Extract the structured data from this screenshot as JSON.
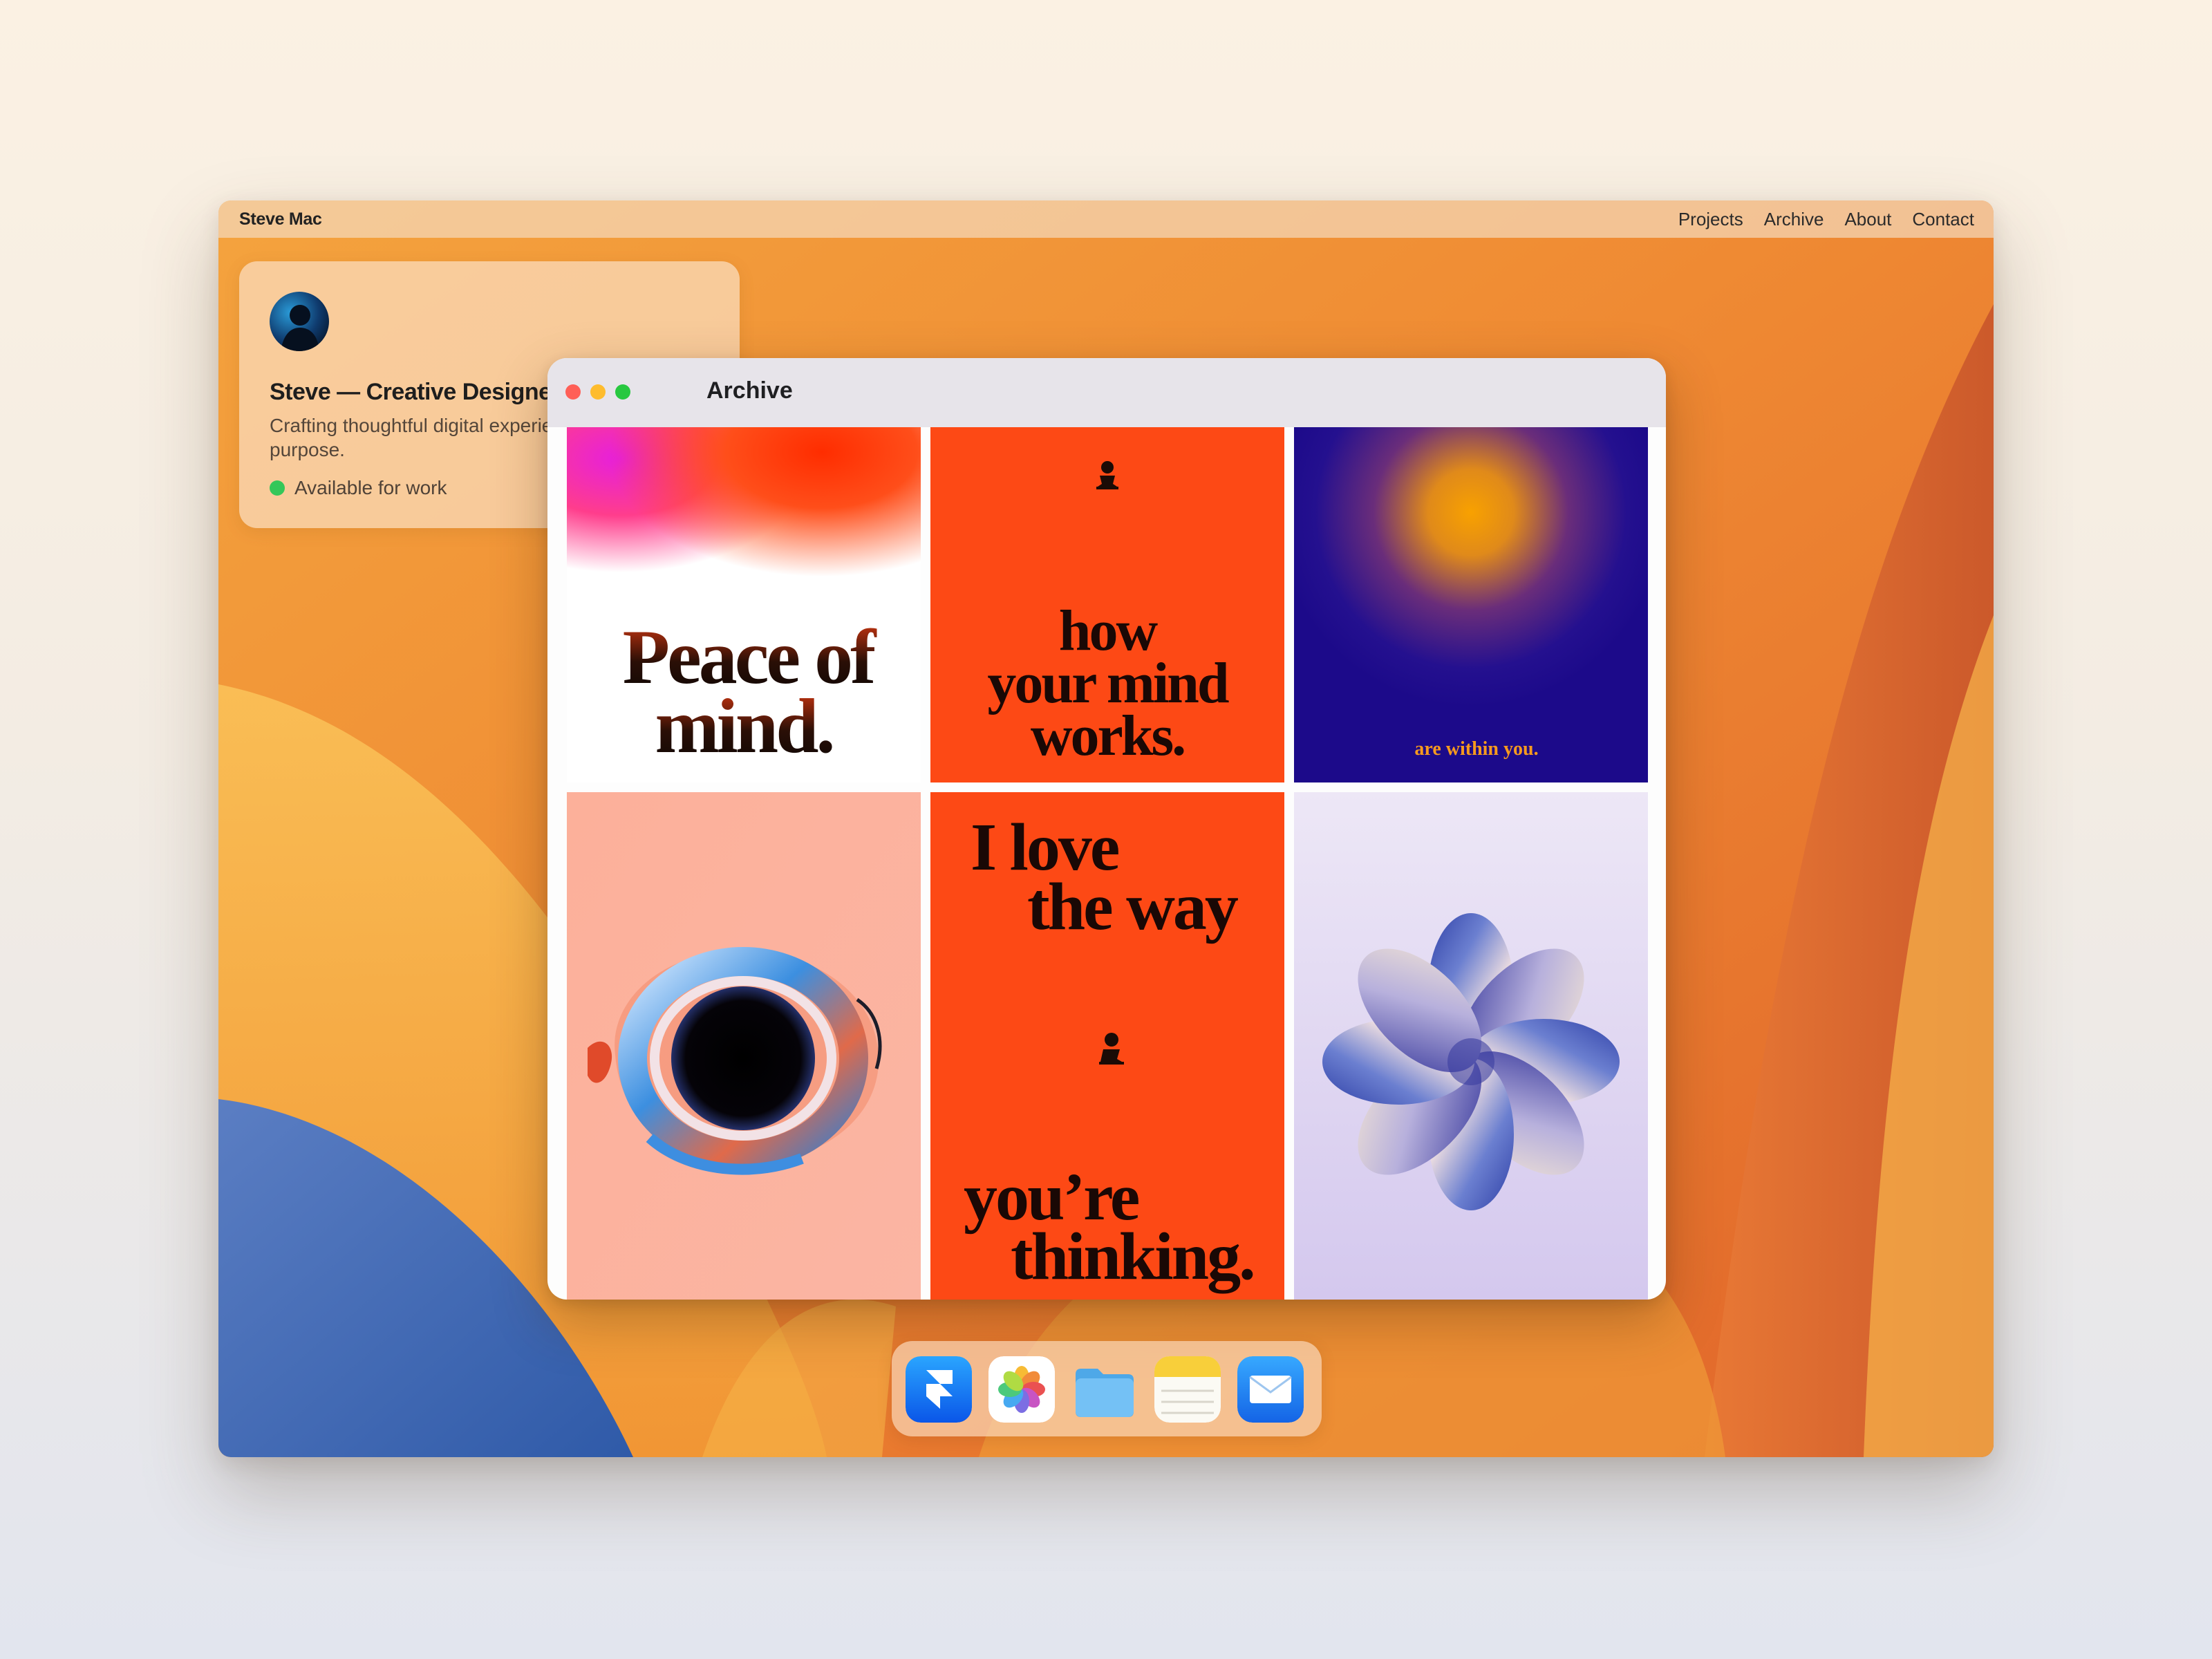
{
  "menubar": {
    "brand": "Steve Mac",
    "nav": [
      "Projects",
      "Archive",
      "About",
      "Contact"
    ]
  },
  "profile": {
    "title": "Steve — Creative Designer",
    "description": "Crafting thoughtful digital experiences with clarity and purpose.",
    "status": "Available for work",
    "status_color": "#35c759"
  },
  "window": {
    "title": "Archive",
    "traffic_lights": [
      "close",
      "minimize",
      "zoom"
    ],
    "tiles": [
      {
        "name": "peace-of-mind",
        "lines": [
          "Peace of",
          "mind."
        ]
      },
      {
        "name": "how-your-mind-works",
        "lines": [
          "how",
          "your mind",
          "works."
        ]
      },
      {
        "name": "are-within-you",
        "lines": [
          "are within you."
        ]
      },
      {
        "name": "dark-orb-swirl",
        "lines": []
      },
      {
        "name": "i-love-the-way",
        "lines": [
          "I love",
          "the way",
          "you’re",
          "thinking."
        ]
      },
      {
        "name": "iridescent-flower",
        "lines": []
      }
    ]
  },
  "dock": {
    "apps": [
      "framer-icon",
      "photos-icon",
      "files-icon",
      "notes-icon",
      "mail-icon"
    ]
  },
  "colors": {
    "accent_orange": "#fd4915",
    "poster_navy": "#1c0a8a",
    "status_green": "#35c759"
  }
}
